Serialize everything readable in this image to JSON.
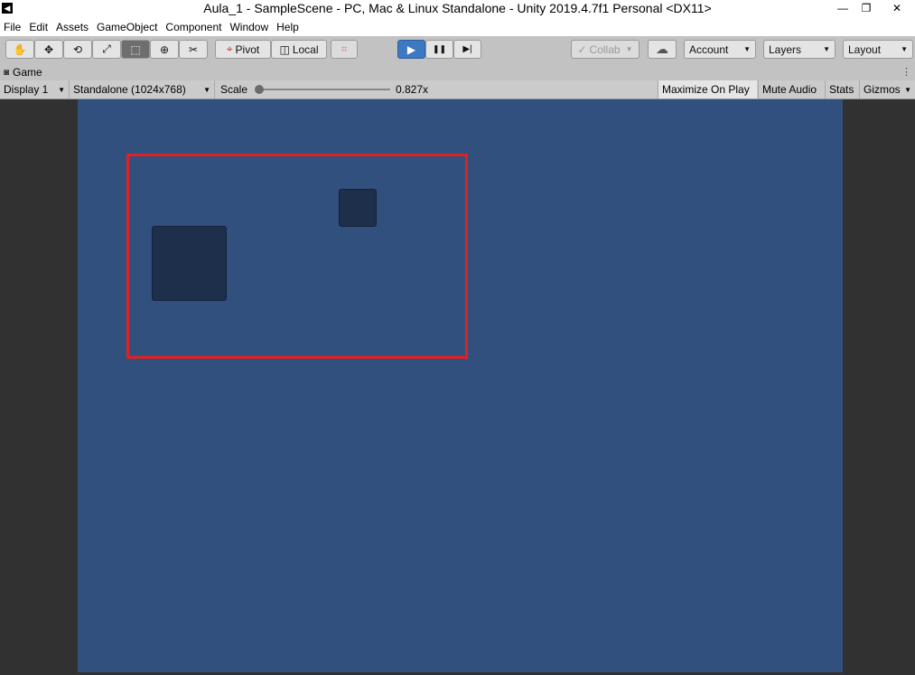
{
  "window": {
    "title": "Aula_1 - SampleScene - PC, Mac & Linux Standalone - Unity 2019.4.7f1 Personal <DX11>",
    "minimize_glyph": "—",
    "restore_glyph": "❐",
    "close_glyph": "✕"
  },
  "menu": [
    "File",
    "Edit",
    "Assets",
    "GameObject",
    "Component",
    "Window",
    "Help"
  ],
  "toolbar": {
    "tools": [
      {
        "icon": "hand-icon",
        "glyph": "✋"
      },
      {
        "icon": "move-icon",
        "glyph": "✥"
      },
      {
        "icon": "rotate-icon",
        "glyph": "⟲"
      },
      {
        "icon": "scale-icon",
        "glyph": "⤢"
      },
      {
        "icon": "rect-tool-icon",
        "glyph": "⬚"
      },
      {
        "icon": "transform-icon",
        "glyph": "⊕"
      },
      {
        "icon": "custom-tool-icon",
        "glyph": "✂"
      }
    ],
    "selected_tool": "rect-tool-icon",
    "pivot_label": "Pivot",
    "local_label": "Local",
    "snap_glyph": "⌗",
    "play_glyph": "▶",
    "pause_glyph": "❚❚",
    "step_glyph": "▶|",
    "collab_label": "Collab",
    "cloud_glyph": "☁",
    "account_label": "Account",
    "layers_label": "Layers",
    "layout_label": "Layout",
    "dropdown_glyph": "▼",
    "check_glyph": "✓",
    "pivot_glyph": "⌖",
    "local_glyph": "◫"
  },
  "game_tab": {
    "label": "Game",
    "icon_glyph": "◙",
    "menu_glyph": "⋮"
  },
  "game_toolbar": {
    "display": "Display 1",
    "resolution": "Standalone (1024x768)",
    "scale_label": "Scale",
    "scale_value": "0.827x",
    "scale_fraction": 0.0,
    "maximize_on_play": "Maximize On Play",
    "maximize_on_play_enabled": true,
    "mute_audio": "Mute Audio",
    "stats": "Stats",
    "gizmos": "Gizmos",
    "caret_glyph": "▼"
  },
  "colors": {
    "camera_background": "#31507d",
    "block": "#1e2f4c",
    "highlight": "#e02024",
    "play_active": "#3d78c2"
  }
}
